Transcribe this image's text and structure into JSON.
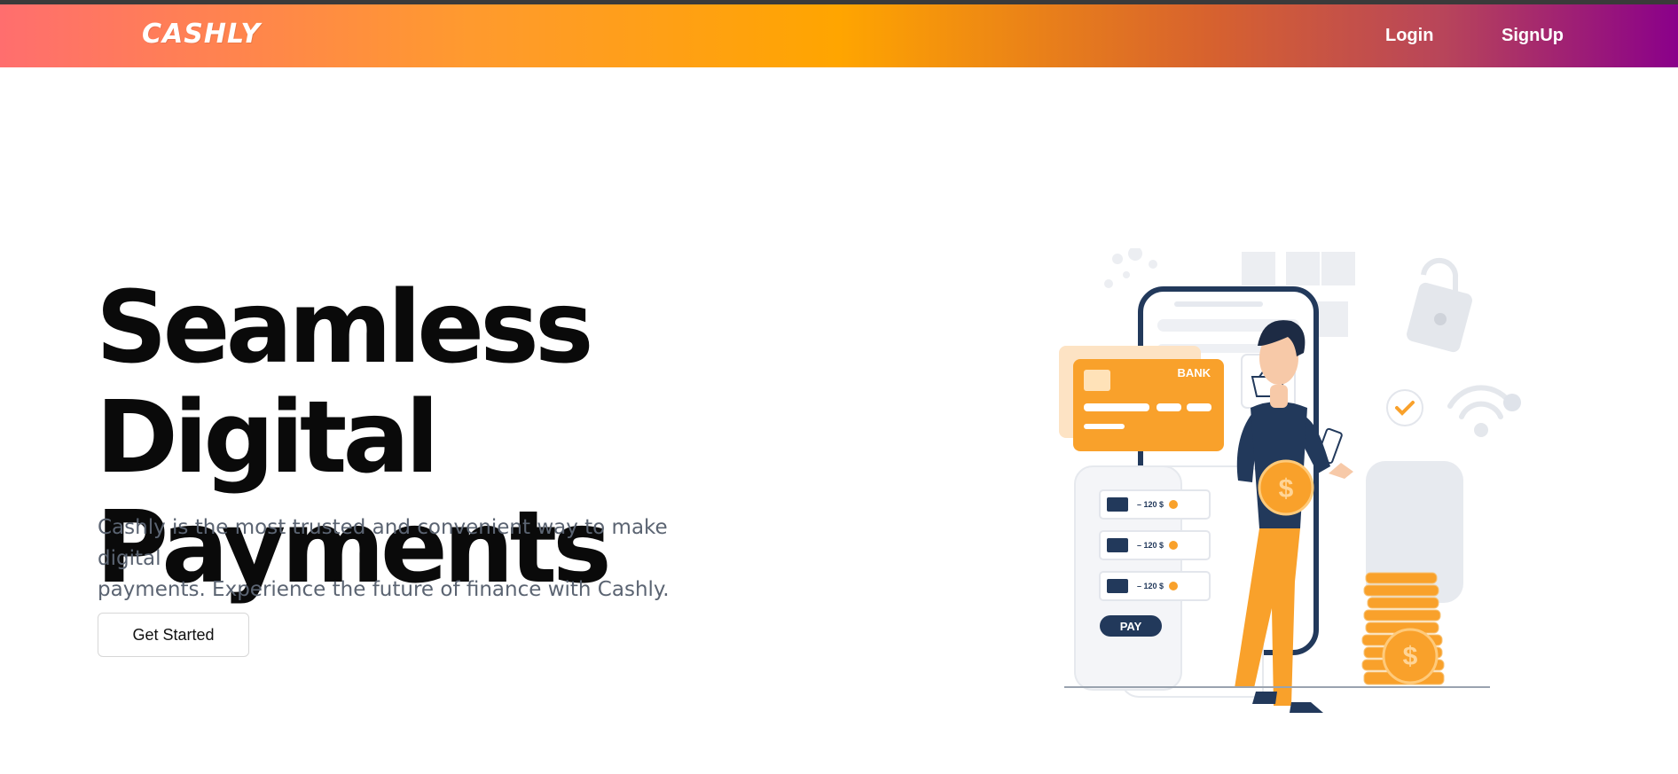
{
  "header": {
    "logo_text": "CASHLY",
    "nav": {
      "login_label": "Login",
      "signup_label": "SignUp"
    }
  },
  "hero": {
    "title_line1": "Seamless Digital",
    "title_line2": "Payments",
    "description_line1": "Cashly is the most trusted and convenient way to make digital",
    "description_line2": "payments. Experience the future of finance with Cashly.",
    "cta_label": "Get Started"
  },
  "illustration": {
    "card_label": "BANK",
    "transaction_amount": "– 120 $",
    "pay_label": "PAY",
    "coin_symbol": "$"
  },
  "colors": {
    "accent_orange": "#f9a12b",
    "navy": "#22395b",
    "text_dark": "#0a0a0a",
    "text_muted": "#5b6472"
  }
}
